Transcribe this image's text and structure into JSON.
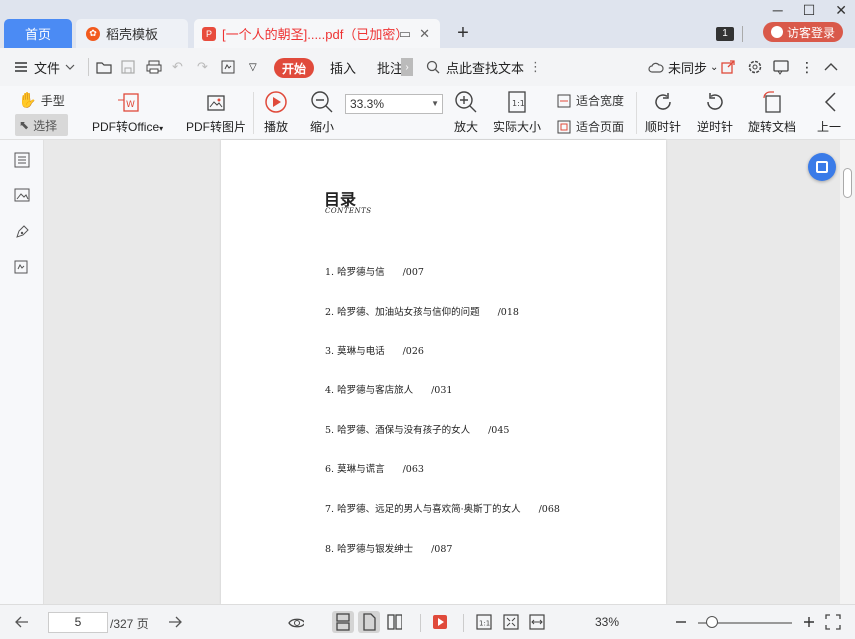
{
  "tabs": {
    "home": "首页",
    "daoke": "稻壳模板",
    "doc_title": "[一个人的朝圣].....pdf（已加密）"
  },
  "titlebar": {
    "badge": "1",
    "login": "访客登录"
  },
  "menubar": {
    "file": "文件",
    "start": "开始",
    "insert": "插入",
    "annotate": "批注",
    "find": "点此查找文本",
    "sync": "未同步"
  },
  "ribbon": {
    "hand": "手型",
    "select": "选择",
    "pdf_to_office": "PDF转Office",
    "pdf_to_image": "PDF转图片",
    "play": "播放",
    "zoom_out": "缩小",
    "zoom_value": "33.3%",
    "zoom_in": "放大",
    "actual_size": "实际大小",
    "fit_width": "适合宽度",
    "fit_page": "适合页面",
    "rotate_cw": "顺时针",
    "rotate_ccw": "逆时针",
    "rotate_doc": "旋转文档",
    "prev": "上一"
  },
  "page": {
    "title": "目录",
    "subtitle": "CONTENTS",
    "entries": [
      {
        "text": "1.  哈罗德与信",
        "page": "/007"
      },
      {
        "text": "2.  哈罗德、加油站女孩与信仰的问题",
        "page": "/018"
      },
      {
        "text": "3.  莫琳与电话",
        "page": "/026"
      },
      {
        "text": "4.  哈罗德与客店旅人",
        "page": "/031"
      },
      {
        "text": "5.  哈罗德、酒保与没有孩子的女人",
        "page": "/045"
      },
      {
        "text": "6.  莫琳与谎言",
        "page": "/063"
      },
      {
        "text": "7.  哈罗德、远足的男人与喜欢简·奥斯丁的女人",
        "page": "/068"
      },
      {
        "text": "8.  哈罗德与银发绅士",
        "page": "/087"
      }
    ]
  },
  "statusbar": {
    "current_page": "5",
    "total_pages": "/327 页",
    "zoom": "33%"
  }
}
